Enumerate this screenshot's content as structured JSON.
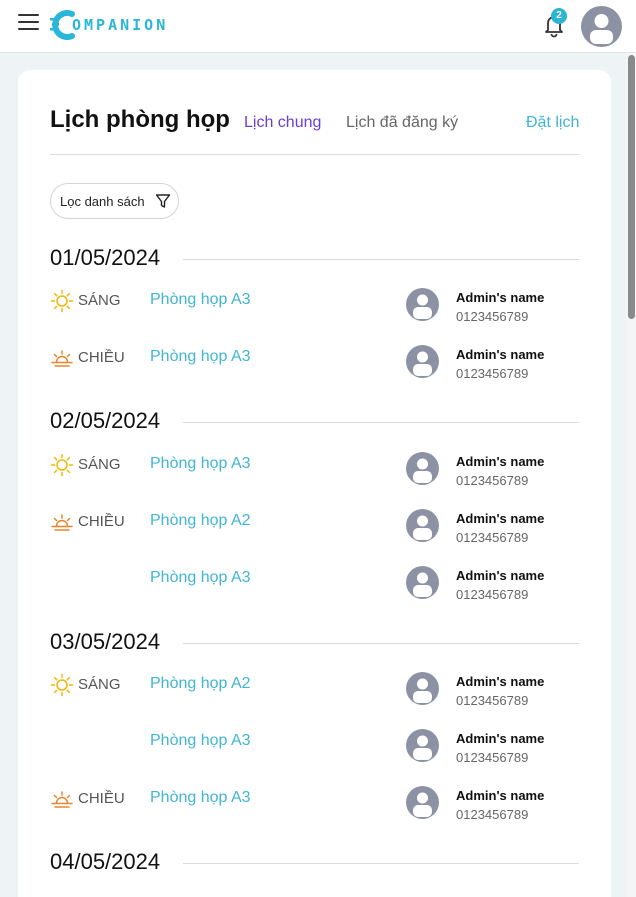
{
  "header": {
    "logo_text": "OMPANION",
    "notification_count": "2"
  },
  "page": {
    "title": "Lịch phòng họp",
    "tabs": [
      "Lịch chung",
      "Lịch đã đăng ký"
    ],
    "book_link": "Đặt lịch",
    "filter_label": "Lọc danh sách"
  },
  "dates": [
    {
      "date": "01/05/2024",
      "rows": [
        {
          "session": "SÁNG",
          "icon": "sun-icon",
          "room": "Phòng họp A3",
          "admin": "Admin's name",
          "phone": "0123456789"
        },
        {
          "session": "CHIỀU",
          "icon": "sunset-icon",
          "room": "Phòng họp A3",
          "admin": "Admin's name",
          "phone": "0123456789"
        }
      ]
    },
    {
      "date": "02/05/2024",
      "rows": [
        {
          "session": "SÁNG",
          "icon": "sun-icon",
          "room": "Phòng họp A3",
          "admin": "Admin's name",
          "phone": "0123456789"
        },
        {
          "session": "CHIỀU",
          "icon": "sunset-icon",
          "room": "Phòng họp A2",
          "admin": "Admin's name",
          "phone": "0123456789"
        },
        {
          "session": "",
          "icon": "",
          "room": "Phòng họp A3",
          "admin": "Admin's name",
          "phone": "0123456789"
        }
      ]
    },
    {
      "date": "03/05/2024",
      "rows": [
        {
          "session": "SÁNG",
          "icon": "sun-icon",
          "room": "Phòng họp A2",
          "admin": "Admin's name",
          "phone": "0123456789"
        },
        {
          "session": "",
          "icon": "",
          "room": "Phòng họp A3",
          "admin": "Admin's name",
          "phone": "0123456789"
        },
        {
          "session": "CHIỀU",
          "icon": "sunset-icon",
          "room": "Phòng họp A3",
          "admin": "Admin's name",
          "phone": "0123456789"
        }
      ]
    },
    {
      "date": "04/05/2024",
      "rows": []
    }
  ],
  "colors": {
    "accent": "#41b6d4",
    "active_tab": "#6a3ed8",
    "sun": "#f2b705",
    "sunset": "#e9852f",
    "avatar": "#8c92a4"
  }
}
